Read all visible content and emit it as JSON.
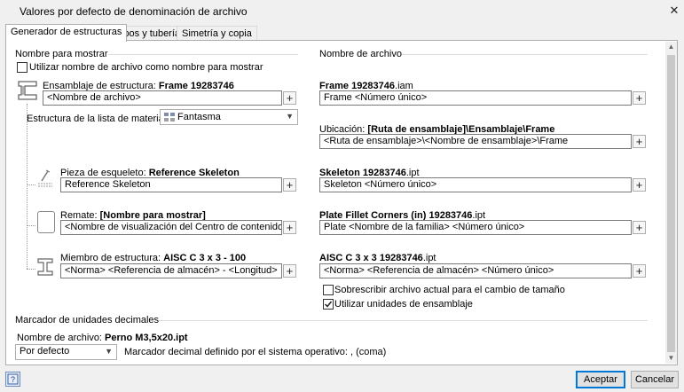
{
  "window": {
    "title": "Valores por defecto de denominación de archivo"
  },
  "tabs": [
    {
      "label": "Generador de estructuras",
      "active": true
    },
    {
      "label": "Tubos y tuberías",
      "active": false
    },
    {
      "label": "Simetría y copia",
      "active": false
    }
  ],
  "left": {
    "section_title": "Nombre para mostrar",
    "use_filename_checkbox": {
      "label": "Utilizar nombre de archivo como nombre para mostrar",
      "checked": false
    },
    "assembly": {
      "label_prefix": "Ensamblaje de estructura: ",
      "label_value": "Frame 19283746",
      "field": "<Nombre de archivo>"
    },
    "bom": {
      "label": "Estructura de la lista de materiales",
      "selected": "Fantasma"
    },
    "skeleton": {
      "label_prefix": "Pieza de esqueleto: ",
      "label_value": "Reference Skeleton",
      "field": "Reference Skeleton"
    },
    "endcap": {
      "label_prefix": "Remate: ",
      "label_value": "[Nombre para mostrar]",
      "field": "<Nombre de visualización del Centro de contenido>"
    },
    "member": {
      "label_prefix": "Miembro de estructura: ",
      "label_value": "AISC C 3 x 3 - 100",
      "field": "<Norma> <Referencia de almacén> - <Longitud>"
    }
  },
  "right": {
    "section_title": "Nombre de archivo",
    "assembly": {
      "label_bold": "Frame 19283746",
      "label_ext": ".iam",
      "field": "Frame <Número único>"
    },
    "location": {
      "label_prefix": "Ubicación: ",
      "label_value": "[Ruta de ensamblaje]\\Ensamblaje\\Frame",
      "field": "<Ruta de ensamblaje>\\<Nombre de ensamblaje>\\Frame"
    },
    "skeleton": {
      "label_bold": "Skeleton 19283746",
      "label_ext": ".ipt",
      "field": "Skeleton <Número único>"
    },
    "endcap": {
      "label_bold": "Plate Fillet Corners (in) 19283746",
      "label_ext": ".ipt",
      "field": "Plate <Nombre de la familia> <Número único>"
    },
    "member": {
      "label_bold": "AISC C 3 x 3 19283746",
      "label_ext": ".ipt",
      "field": "<Norma> <Referencia de almacén> <Número único>"
    },
    "overwrite_checkbox": {
      "label": "Sobrescribir archivo actual para el cambio de tamaño",
      "checked": false
    },
    "units_checkbox": {
      "label": "Utilizar unidades de ensamblaje",
      "checked": true
    }
  },
  "decimal": {
    "section_title": "Marcador de unidades decimales",
    "filename_prefix": "Nombre de archivo: ",
    "filename_value": "Perno M3,5x20.ipt",
    "selected": "Por defecto",
    "note": "Marcador decimal definido por el sistema operativo: , (coma)"
  },
  "buttons": {
    "plus": "+",
    "accept": "Aceptar",
    "cancel": "Cancelar"
  },
  "icons": {
    "assembly": "frame-assembly-icon",
    "bom": "phantom-bom-icon",
    "skeleton": "skeleton-part-icon",
    "endcap": "end-cap-icon",
    "member": "i-beam-icon",
    "help": "help-icon"
  }
}
